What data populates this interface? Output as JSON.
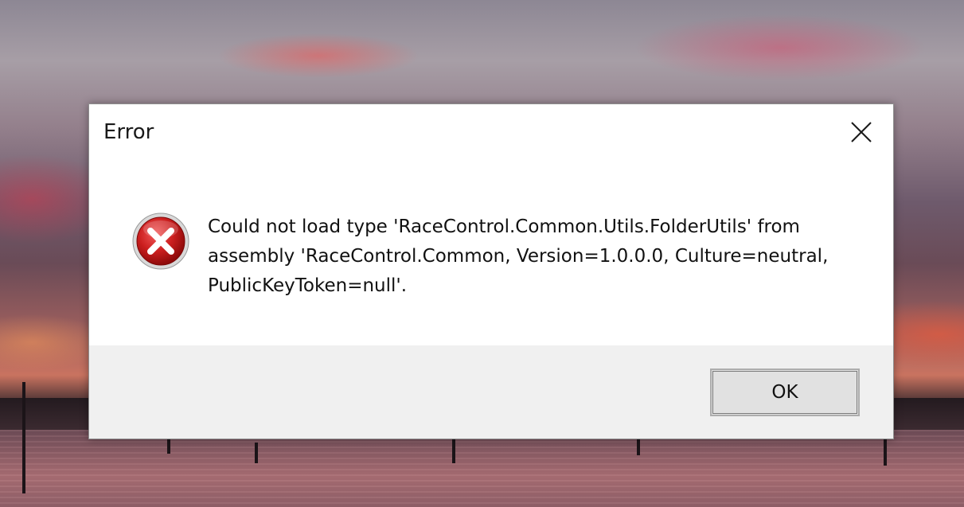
{
  "dialog": {
    "title": "Error",
    "icon": "error-icon",
    "message_lines": [
      "Could not load type 'RaceControl.Common.Utils.FolderUtils' from",
      "assembly 'RaceControl.Common, Version=1.0.0.0, Culture=neutral,",
      "PublicKeyToken=null'."
    ],
    "ok_label": "OK",
    "close_icon": "close-icon"
  },
  "colors": {
    "dialog_background": "#ffffff",
    "footer_background": "#f0f0f0",
    "error_icon_red": "#c8102e",
    "button_face": "#e1e1e1"
  }
}
